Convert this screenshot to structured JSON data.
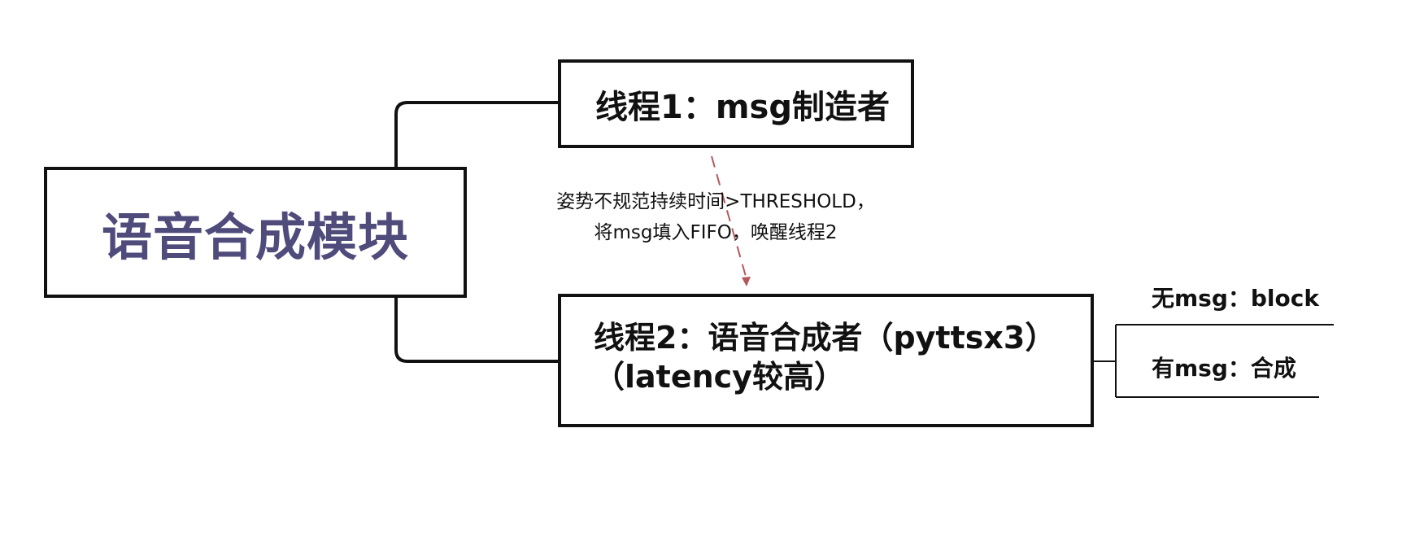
{
  "root": {
    "label": "语音合成模块"
  },
  "thread1": {
    "label": "线程1：msg制造者"
  },
  "thread2": {
    "line1": "线程2：语音合成者（pyttsx3）",
    "line2": "（latency较高）"
  },
  "annotation": {
    "line1": "姿势不规范持续时间>THRESHOLD，",
    "line2": "将msg填入FIFO，唤醒线程2"
  },
  "leaves": {
    "no_msg": "无msg：block",
    "has_msg": "有msg：合成"
  },
  "colors": {
    "root_text": "#4f4b7b",
    "stroke": "#111111",
    "dashed_arrow": "#b5585b"
  }
}
